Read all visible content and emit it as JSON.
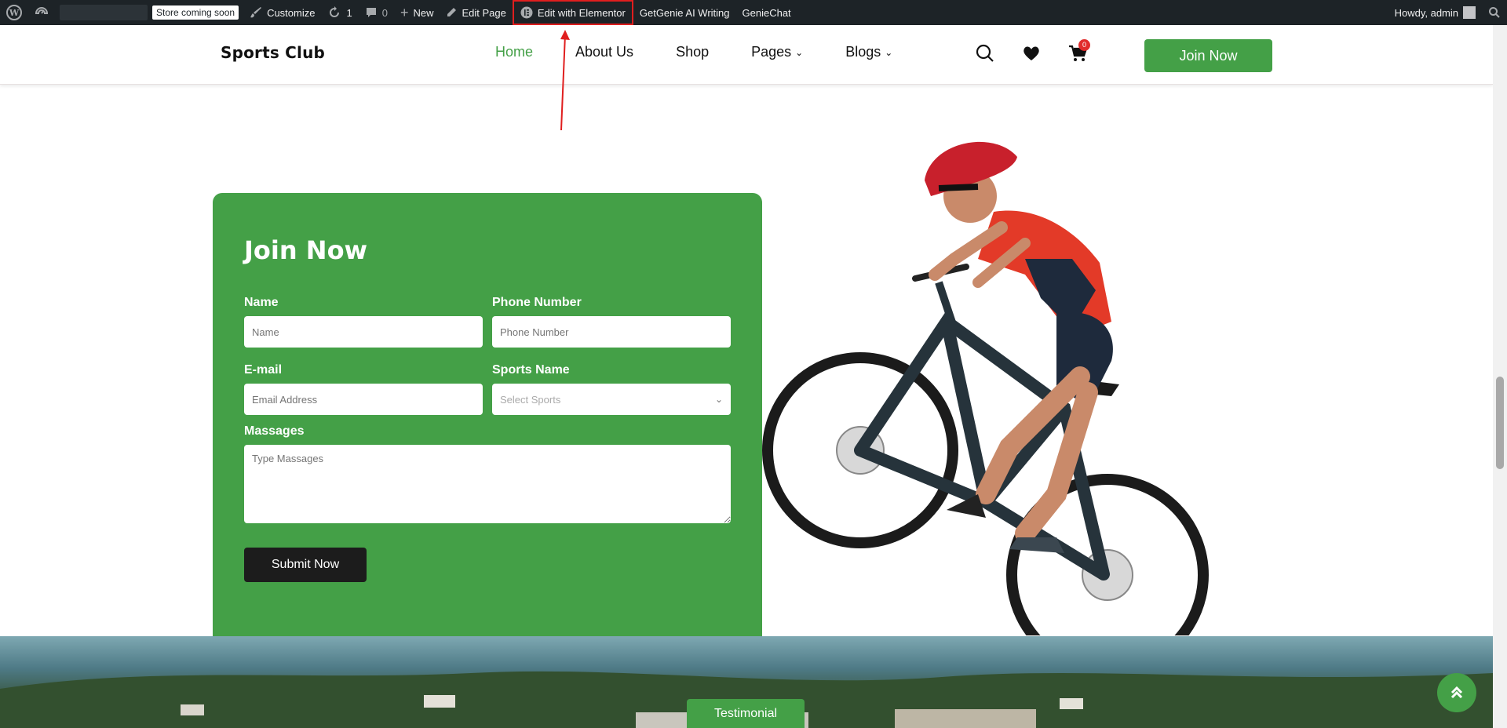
{
  "admin_bar": {
    "store_badge": "Store coming soon",
    "customize": "Customize",
    "updates_count": "1",
    "comments_count": "0",
    "new": "New",
    "edit_page": "Edit Page",
    "edit_elementor": "Edit with Elementor",
    "getgenie": "GetGenie AI Writing",
    "geniechat": "GenieChat",
    "howdy": "Howdy, admin"
  },
  "header": {
    "logo": "Sports Club",
    "nav": [
      {
        "label": "Home",
        "active": true
      },
      {
        "label": "About Us"
      },
      {
        "label": "Shop"
      },
      {
        "label": "Pages",
        "dropdown": true
      },
      {
        "label": "Blogs",
        "dropdown": true
      }
    ],
    "cart_count": "0",
    "join_button": "Join Now"
  },
  "form": {
    "title": "Join Now",
    "name_label": "Name",
    "name_placeholder": "Name",
    "phone_label": "Phone Number",
    "phone_placeholder": "Phone Number",
    "email_label": "E-mail",
    "email_placeholder": "Email Address",
    "sports_label": "Sports Name",
    "sports_selected": "Select Sports",
    "message_label": "Massages",
    "message_placeholder": "Type Massages",
    "submit": "Submit Now"
  },
  "banner": {
    "testimonial_tab": "Testimonial"
  },
  "colors": {
    "accent": "#44a047",
    "admin_bar": "#1d2327",
    "annotation": "#e01e1e"
  }
}
